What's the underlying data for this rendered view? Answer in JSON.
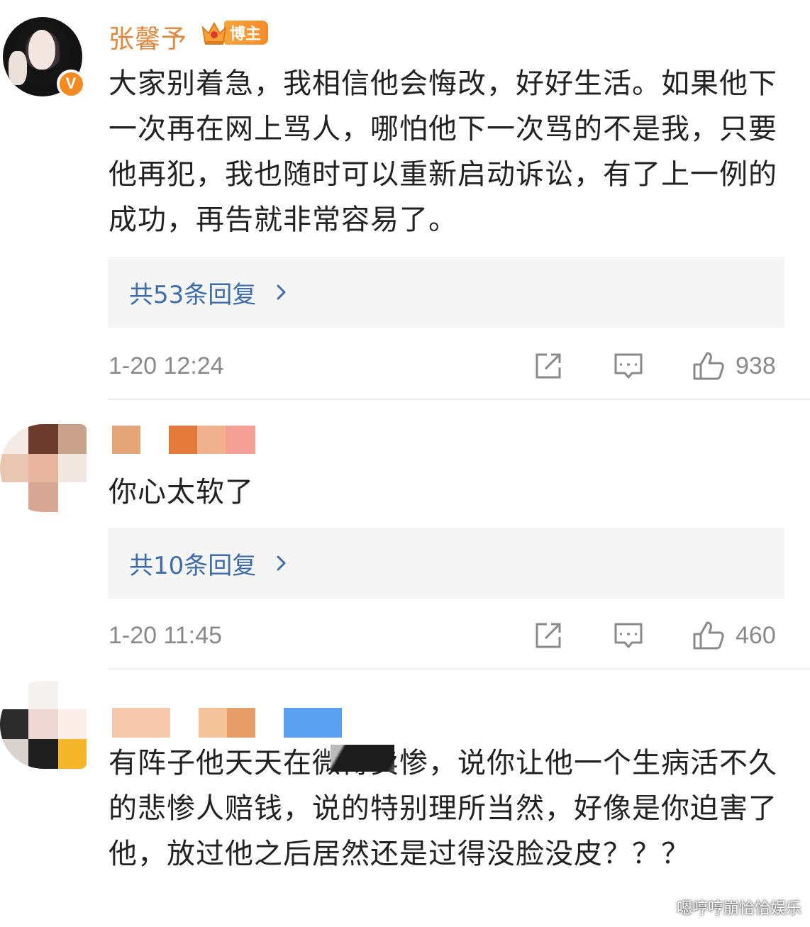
{
  "comments": [
    {
      "username": "张馨予",
      "badge_label": "博主",
      "verified_mark": "V",
      "text": "大家别着急，我相信他会悔改，好好生活。如果他下一次再在网上骂人，哪怕他下一次骂的不是我，只要他再犯，我也随时可以重新启动诉讼，有了上一例的成功，再告就非常容易了。",
      "replies_label": "共53条回复",
      "time": "1-20 12:24",
      "likes": "938"
    },
    {
      "username": "",
      "text": "你心太软了",
      "replies_label": "共10条回复",
      "time": "1-20 11:45",
      "likes": "460"
    },
    {
      "username": "",
      "text": "有阵子他天天在微博卖惨，说你让他一个生病活不久的悲惨人赔钱，说的特别理所当然，好像是你迫害了他，放过他之后居然还是过得没脸没皮？？？"
    }
  ],
  "icons": {
    "share": "share-icon",
    "comment": "comment-icon",
    "like": "thumbs-up-icon",
    "chevron": "chevron-right-icon",
    "crown": "crown-icon"
  },
  "colors": {
    "username": "#e2873b",
    "reply_link": "#3d6ca8",
    "reply_bg": "#f5f5f6",
    "meta": "#8a8a8a",
    "verified": "#f48a1f"
  },
  "watermark": "嗯哼哼崩恰恰娱乐"
}
